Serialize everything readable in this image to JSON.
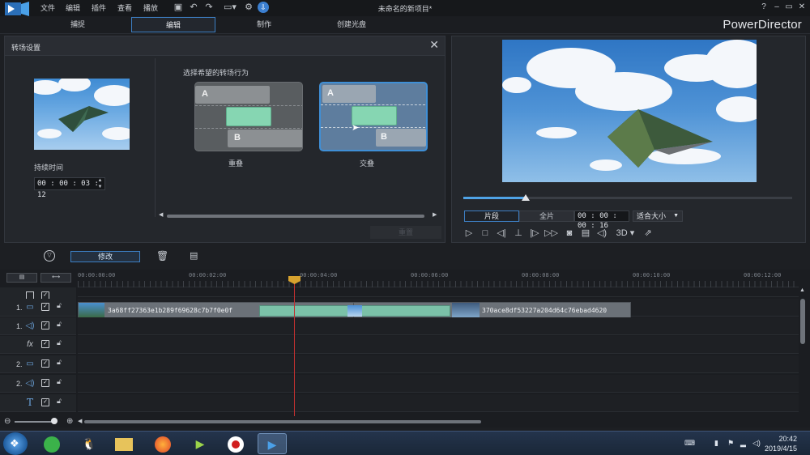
{
  "menu": {
    "items": [
      "文件",
      "编辑",
      "插件",
      "查看",
      "播放"
    ],
    "title": "未命名的新项目*",
    "help": "?",
    "min": "–",
    "max": "▭",
    "close": "✕"
  },
  "tabs": [
    "捕捉",
    "编辑",
    "制作",
    "创建光盘"
  ],
  "brand": "PowerDirector",
  "transition_panel": {
    "title": "转场设置",
    "duration_label": "持续时间",
    "duration_value": "00 : 00 : 03 : 12",
    "choose_label": "选择希望的转场行为",
    "option_a": {
      "label": "重叠",
      "a": "A",
      "b": "B"
    },
    "option_b": {
      "label": "交叠",
      "a": "A",
      "b": "B"
    },
    "apply_label": "重置"
  },
  "preview": {
    "progress": 0.19,
    "clip_mode": "片段",
    "full_mode": "全片",
    "timecode": "00 : 00 : 00 : 16",
    "fit": "适合大小",
    "three_d": "3D"
  },
  "toolbar": {
    "modify_label": "修改"
  },
  "timeline": {
    "ruler_labels": [
      "00:00:00:00",
      "00:00:02:00",
      "00:00:04:00",
      "00:00:06:00",
      "00:00:08:00",
      "00:00:10:00",
      "00:00:12:00"
    ],
    "tracks": [
      {
        "num": "1.",
        "icon": "video-track-icon"
      },
      {
        "num": "1.",
        "icon": "audio-track-icon"
      },
      {
        "num": "",
        "icon": "fx-track-icon"
      },
      {
        "num": "2.",
        "icon": "video-track-icon"
      },
      {
        "num": "2.",
        "icon": "audio-track-icon"
      },
      {
        "num": "",
        "icon": "title-track-icon"
      }
    ],
    "clip1_name": "3a68ff27363e1b289f69628c7b7f0e0f",
    "clip2_name": "370ace8df53227a204d64c76ebad4620"
  },
  "taskbar": {
    "time": "20:42",
    "date": "2019/4/15"
  },
  "colors": {
    "accent": "#3d7fc4",
    "transition": "#7bc1a8",
    "playhead": "#c03030"
  }
}
